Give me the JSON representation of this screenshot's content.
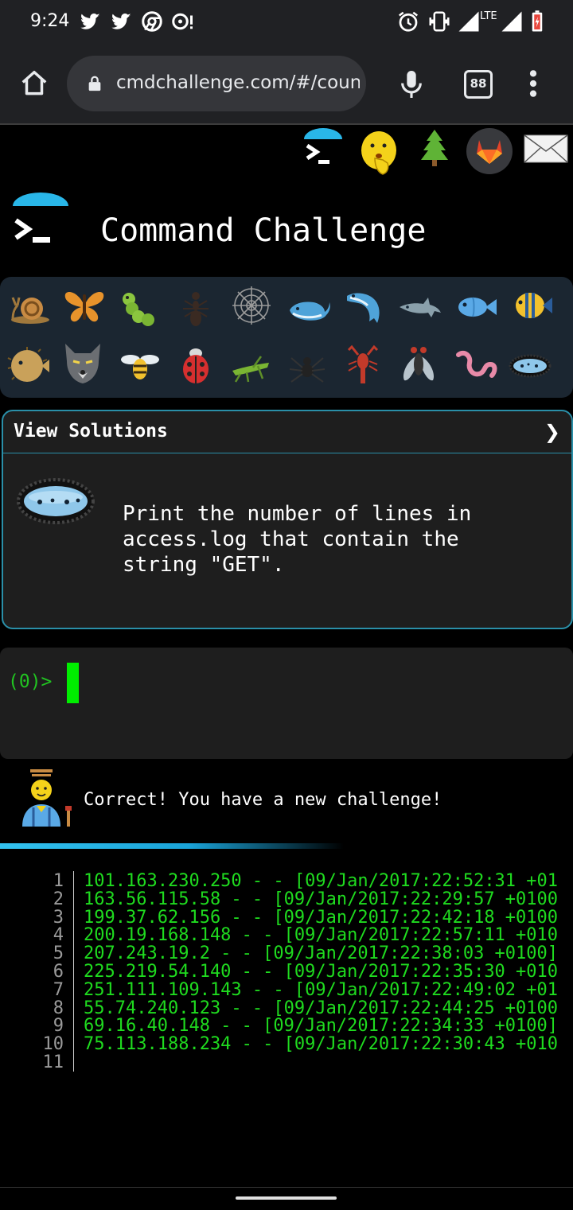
{
  "status": {
    "time": "9:24",
    "network_label": "LTE",
    "icons": [
      "twitter-icon",
      "twitter-icon",
      "chrome-icon",
      "notification-icon",
      "alarm-icon",
      "vibrate-icon",
      "signal-icon",
      "signal-icon",
      "battery-icon"
    ]
  },
  "browser": {
    "url": "cmdchallenge.com/#/count",
    "tab_count": "88",
    "icons": [
      "home-icon",
      "lock-icon",
      "mic-icon",
      "tabs-icon",
      "menu-icon"
    ]
  },
  "header_icons": [
    "terminal-logo-icon",
    "shushing-face-icon",
    "tree-icon",
    "gitlab-icon",
    "mail-icon"
  ],
  "title": "Command Challenge",
  "critters": {
    "row1": [
      "snail-icon",
      "butterfly-icon",
      "caterpillar-icon",
      "ant-icon",
      "spiderweb-icon",
      "whale-icon",
      "whale2-icon",
      "dolphin-icon",
      "fish-icon",
      "tropical-fish-icon"
    ],
    "row2": [
      "blowfish-icon",
      "wolf-icon",
      "bee-icon",
      "ladybug-icon",
      "cricket-icon",
      "spider-icon",
      "scorpion-icon",
      "fly-icon",
      "worm-icon",
      "microbe-icon"
    ]
  },
  "challenge": {
    "header": "View Solutions",
    "chevron": "❯",
    "icon": "microbe-icon",
    "description": "Print the number of lines in access.log that contain the string \"GET\"."
  },
  "terminal": {
    "prompt": "(0)>"
  },
  "message": {
    "icon": "farmer-icon",
    "text": "Correct! You have a new challenge!"
  },
  "progress": {
    "fraction": 0.6
  },
  "output": {
    "lines": [
      {
        "n": "1",
        "text": "101.163.230.250 - - [09/Jan/2017:22:52:31 +01"
      },
      {
        "n": "2",
        "text": "163.56.115.58 - - [09/Jan/2017:22:29:57 +0100"
      },
      {
        "n": "3",
        "text": "199.37.62.156 - - [09/Jan/2017:22:42:18 +0100"
      },
      {
        "n": "4",
        "text": "200.19.168.148 - - [09/Jan/2017:22:57:11 +010"
      },
      {
        "n": "5",
        "text": "207.243.19.2 - - [09/Jan/2017:22:38:03 +0100]"
      },
      {
        "n": "6",
        "text": "225.219.54.140 - - [09/Jan/2017:22:35:30 +010"
      },
      {
        "n": "7",
        "text": "251.111.109.143 - - [09/Jan/2017:22:49:02 +01"
      },
      {
        "n": "8",
        "text": "55.74.240.123 - - [09/Jan/2017:22:44:25 +0100"
      },
      {
        "n": "9",
        "text": "69.16.40.148 - - [09/Jan/2017:22:34:33 +0100]"
      },
      {
        "n": "10",
        "text": "75.113.188.234 - - [09/Jan/2017:22:30:43 +010"
      },
      {
        "n": "11",
        "text": ""
      }
    ]
  },
  "colors": {
    "accent": "#2a8fa8",
    "terminal_green": "#1fdb1f",
    "cursor": "#00ee00",
    "critter_bg": "#1b2631"
  }
}
